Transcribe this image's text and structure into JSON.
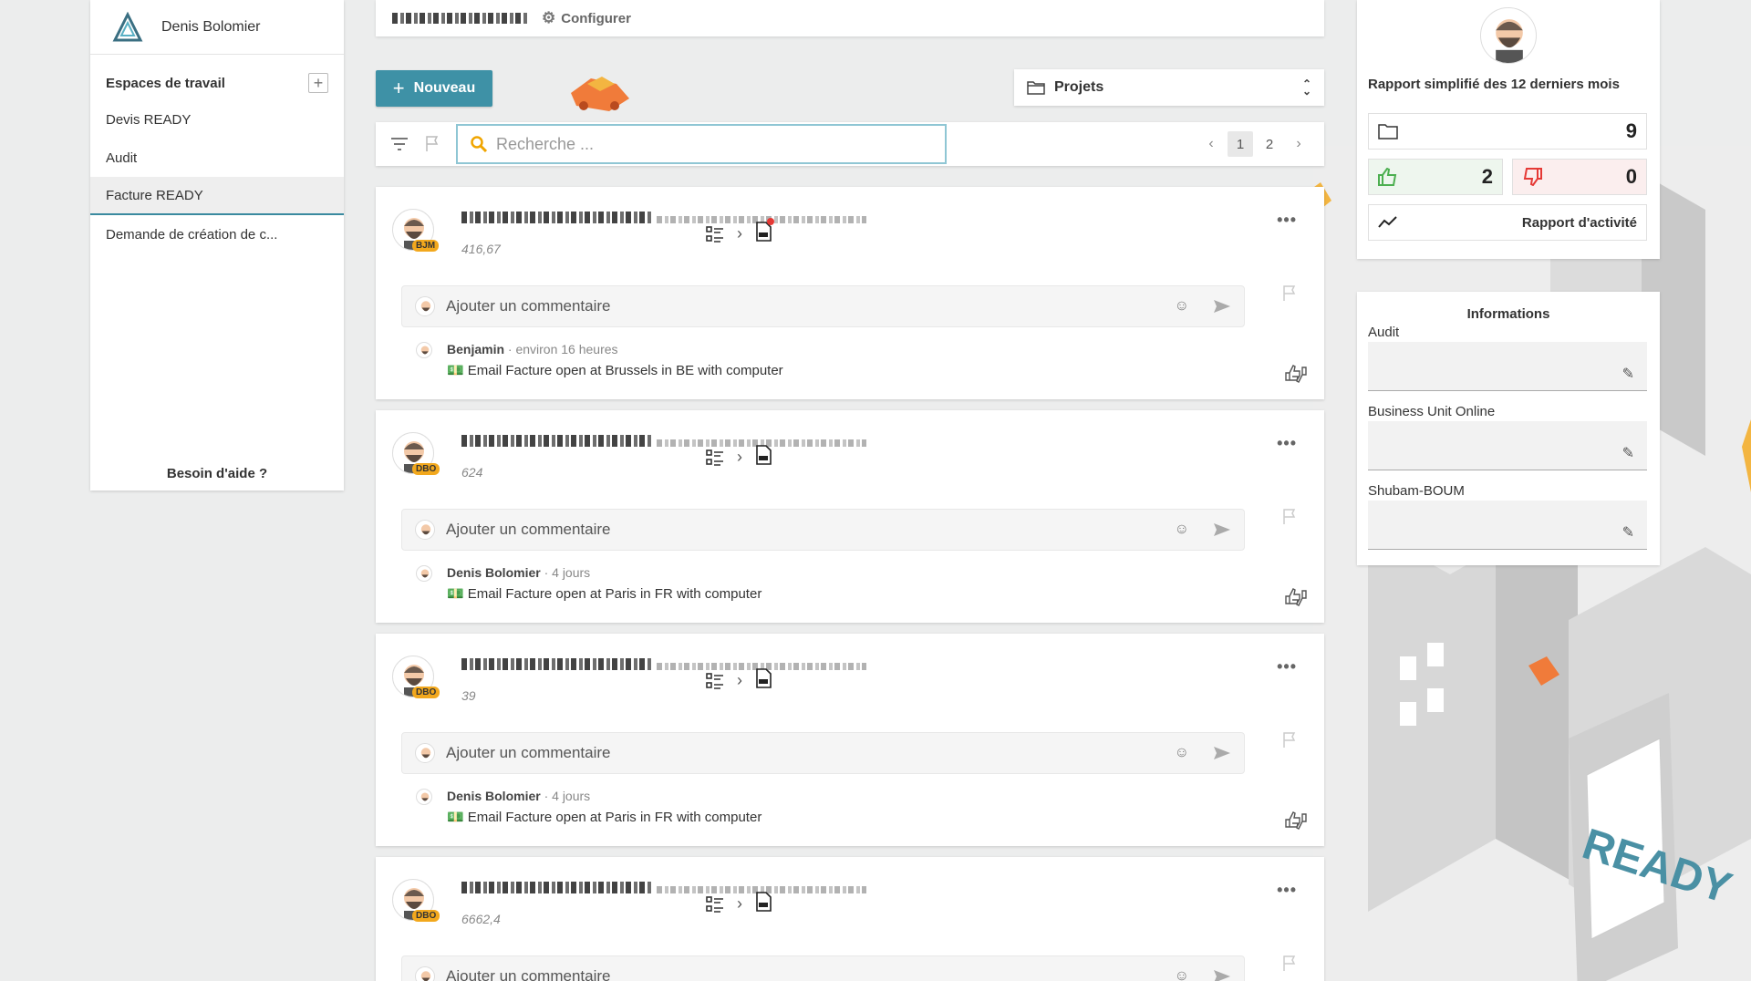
{
  "sidebar": {
    "user_name": "Denis Bolomier",
    "section_title": "Espaces de travail",
    "add_label": "+",
    "items": [
      {
        "label": "Devis READY",
        "active": false
      },
      {
        "label": "Audit",
        "active": false
      },
      {
        "label": "Facture READY",
        "active": true
      },
      {
        "label": "Demande de création de c...",
        "active": false
      }
    ],
    "help_label": "Besoin d'aide ?"
  },
  "topbar": {
    "configure_label": "Configurer"
  },
  "actions": {
    "new_label": "Nouveau",
    "project_select": "Projets"
  },
  "search": {
    "placeholder": "Recherche ...",
    "pages": [
      "1",
      "2"
    ],
    "current_page": "1"
  },
  "cards": [
    {
      "badge": "BJM",
      "amount": "416,67",
      "has_notification": true,
      "comment_placeholder": "Ajouter un commentaire",
      "author": "Benjamin",
      "time": "environ 16 heures",
      "message": "Email Facture open at Brussels in BE with computer"
    },
    {
      "badge": "DBO",
      "amount": "624",
      "has_notification": false,
      "comment_placeholder": "Ajouter un commentaire",
      "author": "Denis Bolomier",
      "time": "4 jours",
      "message": "Email Facture open at Paris in FR with computer"
    },
    {
      "badge": "DBO",
      "amount": "39",
      "has_notification": false,
      "comment_placeholder": "Ajouter un commentaire",
      "author": "Denis Bolomier",
      "time": "4 jours",
      "message": "Email Facture open at Paris in FR with computer"
    },
    {
      "badge": "DBO",
      "amount": "6662,4",
      "has_notification": false,
      "comment_placeholder": "Ajouter un commentaire"
    }
  ],
  "report": {
    "title": "Rapport simplifié des 12 derniers mois",
    "folder_count": "9",
    "thumbs_up_count": "2",
    "thumbs_down_count": "0",
    "activity_label": "Rapport d'activité"
  },
  "informations": {
    "title": "Informations",
    "fields": [
      {
        "label": "Audit",
        "value": ""
      },
      {
        "label": "Business Unit Online",
        "value": ""
      },
      {
        "label": "Shubam-BOUM",
        "value": ""
      }
    ]
  },
  "colors": {
    "accent": "#3e91a6",
    "badge": "#f2a81d",
    "search_border": "#8fc6d4",
    "notification": "#e53935"
  }
}
